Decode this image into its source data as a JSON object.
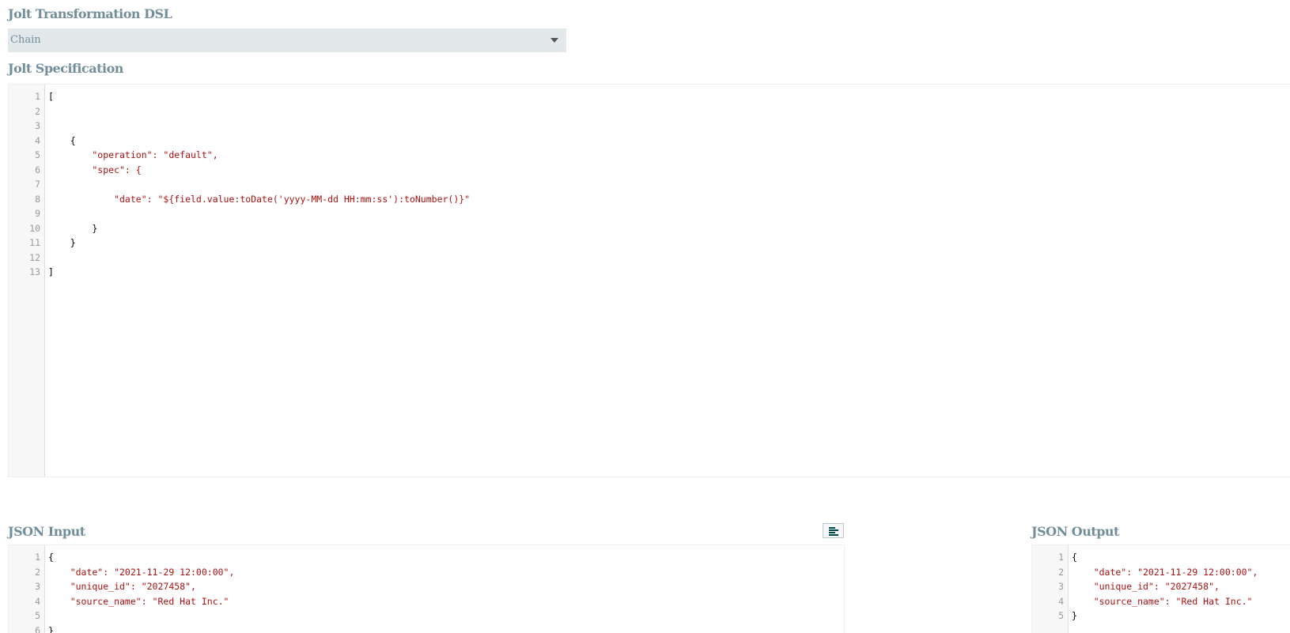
{
  "dsl": {
    "heading": "Jolt Transformation DSL",
    "selected": "Chain"
  },
  "spec": {
    "heading": "Jolt Specification",
    "lines": [
      "[",
      "",
      "",
      "    {",
      "        \"operation\": \"default\",",
      "        \"spec\": {",
      "",
      "            \"date\": \"${field.value:toDate('yyyy-MM-dd HH:mm:ss'):toNumber()}\"",
      "",
      "        }",
      "    }",
      "",
      "]"
    ]
  },
  "input": {
    "heading": "JSON Input",
    "format_button": "format-icon",
    "lines": [
      "{",
      "    \"date\": \"2021-11-29 12:00:00\",",
      "    \"unique_id\": \"2027458\",",
      "    \"source_name\": \"Red Hat Inc.\"",
      "",
      "}"
    ]
  },
  "output": {
    "heading": "JSON Output",
    "lines": [
      "{",
      "    \"date\": \"2021-11-29 12:00:00\",",
      "    \"unique_id\": \"2027458\",",
      "    \"source_name\": \"Red Hat Inc.\"",
      "}"
    ]
  }
}
